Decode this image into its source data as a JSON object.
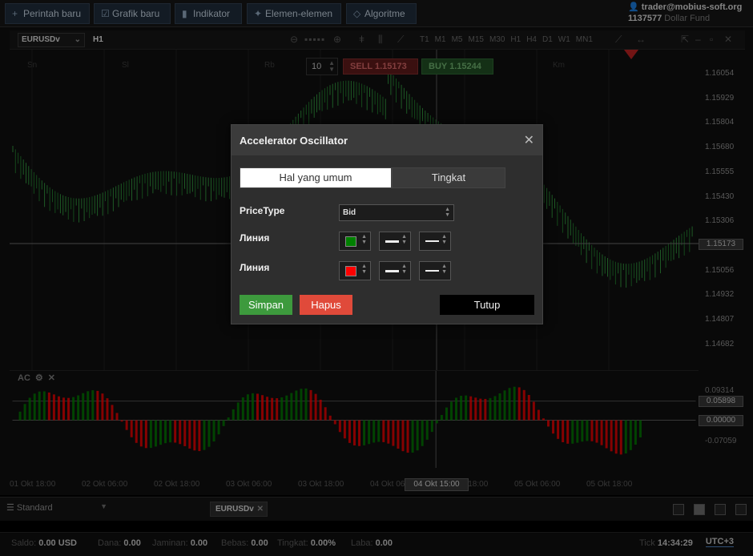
{
  "topbar": {
    "buttons": [
      {
        "label": "Perintah baru",
        "icon": "plus-icon"
      },
      {
        "label": "Grafik baru",
        "icon": "chart-icon"
      },
      {
        "label": "Indikator",
        "icon": "bars-icon"
      },
      {
        "label": "Elemen-elemen",
        "icon": "shapes-icon"
      },
      {
        "label": "Algoritme",
        "icon": "diamond-icon"
      }
    ],
    "account": {
      "email": "trader@mobius-soft.org",
      "id": "1137577",
      "fund": "Dollar Fund"
    }
  },
  "chart_toolbar": {
    "symbol": "EURUSDv",
    "timeframe": "H1",
    "timeframes": [
      "T1",
      "M1",
      "M5",
      "M15",
      "M30",
      "H1",
      "H4",
      "D1",
      "W1",
      "MN1"
    ]
  },
  "day_labels": [
    "Sn",
    "Sl",
    "Rb",
    "Km"
  ],
  "trade": {
    "lot": "10",
    "sell_label": "SELL",
    "sell_price": "1.15173",
    "buy_label": "BUY",
    "buy_price": "1.15244"
  },
  "price_axis": [
    "1.16054",
    "1.15929",
    "1.15804",
    "1.15680",
    "1.15555",
    "1.15430",
    "1.15306",
    "1.15173",
    "1.15056",
    "1.14932",
    "1.14807",
    "1.14682"
  ],
  "current_price": "1.15173",
  "indicator": {
    "name": "AC",
    "axis": [
      "0.09314",
      "0.05898",
      "0.00000",
      "-0.07059"
    ],
    "tag_upper": "0.05898",
    "tag_zero": "0.00000"
  },
  "time_axis": [
    "01 Okt 18:00",
    "02 Okt 06:00",
    "02 Okt 18:00",
    "03 Okt 06:00",
    "03 Okt 18:00",
    "04 Okt 06:00",
    "04 Okt 18:00",
    "05 Okt 06:00",
    "05 Okt 18:00"
  ],
  "time_cursor": "04 Okt 15:00",
  "bottom": {
    "layout": "Standard",
    "tab": "EURUSDv"
  },
  "status": {
    "saldo_label": "Saldo:",
    "saldo": "0.00",
    "saldo_cur": "USD",
    "dana_label": "Dana:",
    "dana": "0.00",
    "jaminan_label": "Jaminan:",
    "jaminan": "0.00",
    "bebas_label": "Bebas:",
    "bebas": "0.00",
    "tingkat_label": "Tingkat:",
    "tingkat": "0.00%",
    "laba_label": "Laba:",
    "laba": "0.00",
    "tick_label": "Tick",
    "time": "14:34:29",
    "tz": "UTC+3"
  },
  "modal": {
    "title": "Accelerator Oscillator",
    "tab_general": "Hal yang umum",
    "tab_levels": "Tingkat",
    "price_type_label": "PriceType",
    "price_type_value": "Bid",
    "line1_label": "Линия",
    "line1_color": "#008000",
    "line2_label": "Линия",
    "line2_color": "#ff0000",
    "save": "Simpan",
    "delete": "Hapus",
    "close": "Tutup"
  }
}
